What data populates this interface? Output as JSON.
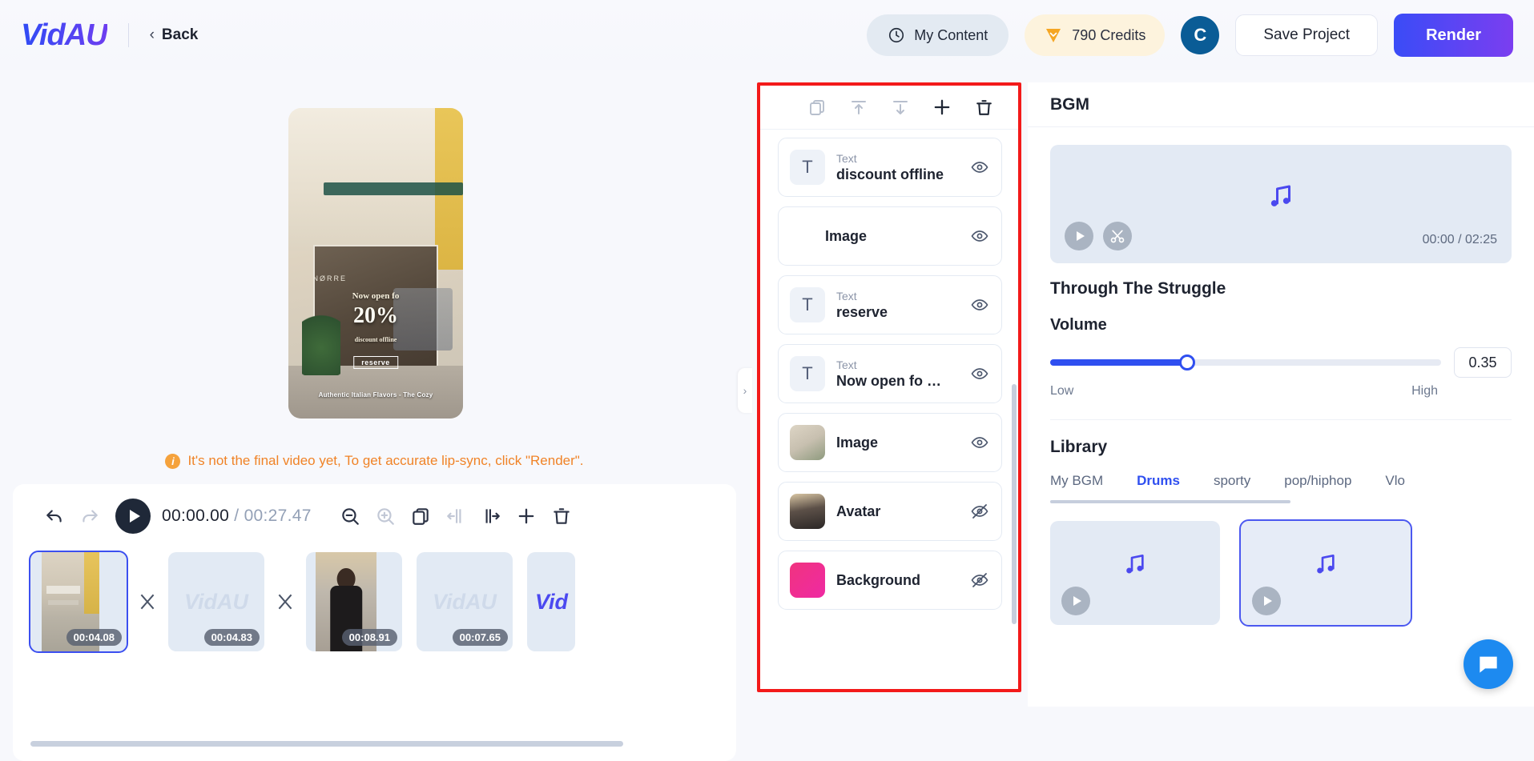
{
  "header": {
    "logo": "VidAU",
    "back_chevron": "‹",
    "back_label": "Back",
    "my_content_label": "My Content",
    "credits_label": "790 Credits",
    "avatar_initial": "C",
    "save_label": "Save Project",
    "render_label": "Render",
    "accent_blue": "#3a4cf7",
    "accent_purple": "#7b3ef0",
    "credits_bg": "#fdf3dd",
    "credits_icon_color": "#f5a623"
  },
  "preview": {
    "overlay_brand": "NØRRE",
    "overlay_line1": "Now open fo",
    "overlay_percent": "20%",
    "overlay_sub": "discount offline",
    "overlay_reserve": "reserve",
    "overlay_bottom": "Authentic Italian Flavors - The Cozy",
    "warning_text": "It's not the final video yet, To get accurate lip-sync, click \"Render\".",
    "warning_icon": "info-icon",
    "warning_color": "#f08327"
  },
  "timeline": {
    "current_time": "00:00.00",
    "separator": "/",
    "total_time": "00:27.47",
    "icons": {
      "undo": "undo-icon",
      "redo": "redo-icon",
      "play": "play-icon",
      "zoom_out": "zoom-out-icon",
      "zoom_in": "zoom-in-icon",
      "duplicate": "duplicate-icon",
      "split_left": "split-left-icon",
      "split_right": "split-right-icon",
      "add": "plus-icon",
      "delete": "trash-icon"
    },
    "clips": [
      {
        "type": "image",
        "duration": "00:04.08",
        "selected": true,
        "watermark": ""
      },
      {
        "type": "watermark",
        "duration": "00:04.83",
        "watermark": "VidAU"
      },
      {
        "type": "image",
        "duration": "00:08.91",
        "watermark": ""
      },
      {
        "type": "watermark",
        "duration": "00:07.65",
        "watermark": "VidAU"
      },
      {
        "type": "watermark",
        "duration": "",
        "watermark": "Vid"
      }
    ],
    "transition_icon": "transition-icon"
  },
  "layers_panel": {
    "highlight_color": "#f31a1a",
    "toolbar": [
      {
        "name": "duplicate-layer-icon",
        "enabled": false
      },
      {
        "name": "align-top-icon",
        "enabled": false
      },
      {
        "name": "align-bottom-icon",
        "enabled": false
      },
      {
        "name": "add-layer-icon",
        "enabled": true
      },
      {
        "name": "delete-layer-icon",
        "enabled": true
      }
    ],
    "items": [
      {
        "kind": "Text",
        "name": "discount offline",
        "thumb": "text",
        "visible": true
      },
      {
        "kind": "",
        "name": "Image",
        "thumb": "none",
        "visible": true
      },
      {
        "kind": "Text",
        "name": "reserve",
        "thumb": "text",
        "visible": true
      },
      {
        "kind": "Text",
        "name": "Now open fo …",
        "thumb": "text",
        "visible": true
      },
      {
        "kind": "",
        "name": "Image",
        "thumb": "street",
        "visible": true
      },
      {
        "kind": "",
        "name": "Avatar",
        "thumb": "person",
        "visible": false
      },
      {
        "kind": "",
        "name": "Background",
        "thumb": "pink",
        "visible": false
      }
    ],
    "collapse_handle": "›"
  },
  "bgm": {
    "title": "BGM",
    "player": {
      "note_icon": "music-note-icon",
      "play_icon": "play-icon",
      "cut_icon": "scissors-icon",
      "current": "00:00",
      "separator": "/",
      "total": "02:25",
      "time_display": "00:00 / 02:25"
    },
    "track_title": "Through The Struggle",
    "volume": {
      "label": "Volume",
      "value": "0.35",
      "percent": 35,
      "low_label": "Low",
      "high_label": "High",
      "fill_color": "#2f4ff0"
    },
    "library": {
      "title": "Library",
      "tabs": [
        {
          "label": "My BGM",
          "active": false
        },
        {
          "label": "Drums",
          "active": true
        },
        {
          "label": "sporty",
          "active": false
        },
        {
          "label": "pop/hiphop",
          "active": false
        },
        {
          "label": "Vlo",
          "active": false
        }
      ],
      "cards": [
        {
          "note_icon": "music-note-icon",
          "selected": false
        },
        {
          "note_icon": "music-note-icon",
          "selected": true
        }
      ]
    }
  },
  "support": {
    "icon": "chat-bubble-icon",
    "color": "#1d8af0"
  }
}
